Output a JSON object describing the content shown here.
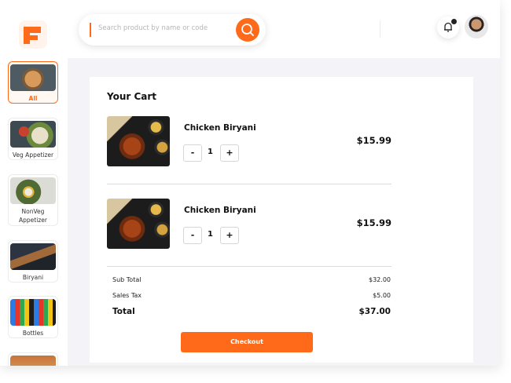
{
  "search": {
    "placeholder": "Search product by name or code"
  },
  "sidebar": {
    "categories": [
      {
        "label": "All",
        "active": true
      },
      {
        "label": "Veg Appetizer",
        "active": false
      },
      {
        "label": "NonVeg Appetizer",
        "active": false
      },
      {
        "label": "Biryani",
        "active": false
      },
      {
        "label": "Bottles",
        "active": false
      },
      {
        "label": "",
        "active": false
      }
    ]
  },
  "cart": {
    "title": "Your Cart",
    "items": [
      {
        "name": "Chicken Biryani",
        "quantity": "1",
        "price": "$15.99",
        "minus": "-",
        "plus": "+"
      },
      {
        "name": "Chicken Biryani",
        "quantity": "1",
        "price": "$15.99",
        "minus": "-",
        "plus": "+"
      }
    ],
    "summary": {
      "subtotal_label": "Sub Total",
      "subtotal_value": "$32.00",
      "tax_label": "Sales Tax",
      "tax_value": "$5.00",
      "total_label": "Total",
      "total_value": "$37.00"
    },
    "checkout_label": "Checkout"
  },
  "colors": {
    "accent": "#ff6a1a",
    "background": "#f4f4f8"
  },
  "icons": [
    "logo-icon",
    "search-icon",
    "bell-icon",
    "avatar"
  ]
}
